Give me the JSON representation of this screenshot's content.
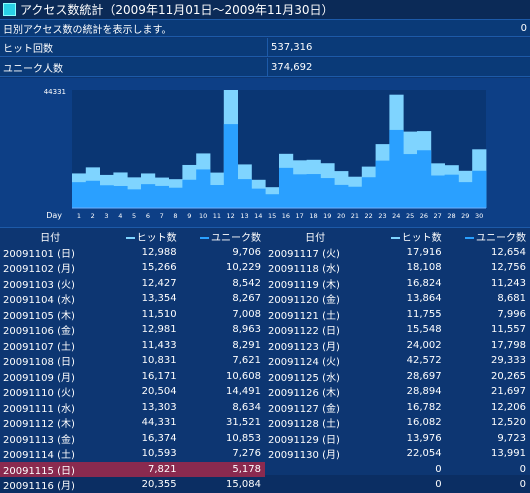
{
  "title": "アクセス数統計（2009年11月01日～2009年11月30日）",
  "subtitle": {
    "text": "日別アクセス数の統計を表示します。",
    "value": "0"
  },
  "summary": [
    {
      "label": "ヒット回数",
      "value": "537,316"
    },
    {
      "label": "ユニーク人数",
      "value": "374,692"
    }
  ],
  "table_headers": {
    "date": "日付",
    "hits": "ヒット数",
    "unique": "ユニーク数"
  },
  "left_rows": [
    {
      "date": "20091101 (日)",
      "hits": "12,988",
      "unique": "9,706"
    },
    {
      "date": "20091102 (月)",
      "hits": "15,266",
      "unique": "10,229"
    },
    {
      "date": "20091103 (火)",
      "hits": "12,427",
      "unique": "8,542"
    },
    {
      "date": "20091104 (水)",
      "hits": "13,354",
      "unique": "8,267"
    },
    {
      "date": "20091105 (木)",
      "hits": "11,510",
      "unique": "7,008"
    },
    {
      "date": "20091106 (金)",
      "hits": "12,981",
      "unique": "8,963"
    },
    {
      "date": "20091107 (土)",
      "hits": "11,433",
      "unique": "8,291"
    },
    {
      "date": "20091108 (日)",
      "hits": "10,831",
      "unique": "7,621"
    },
    {
      "date": "20091109 (月)",
      "hits": "16,171",
      "unique": "10,608"
    },
    {
      "date": "20091110 (火)",
      "hits": "20,504",
      "unique": "14,491"
    },
    {
      "date": "20091111 (水)",
      "hits": "13,303",
      "unique": "8,634"
    },
    {
      "date": "20091112 (木)",
      "hits": "44,331",
      "unique": "31,521"
    },
    {
      "date": "20091113 (金)",
      "hits": "16,374",
      "unique": "10,853"
    },
    {
      "date": "20091114 (土)",
      "hits": "10,593",
      "unique": "7,276"
    },
    {
      "date": "20091115 (日)",
      "hits": "7,821",
      "unique": "5,178"
    },
    {
      "date": "20091116 (月)",
      "hits": "20,355",
      "unique": "15,084"
    }
  ],
  "right_rows": [
    {
      "date": "20091117 (火)",
      "hits": "17,916",
      "unique": "12,654"
    },
    {
      "date": "20091118 (水)",
      "hits": "18,108",
      "unique": "12,756"
    },
    {
      "date": "20091119 (木)",
      "hits": "16,824",
      "unique": "11,243"
    },
    {
      "date": "20091120 (金)",
      "hits": "13,864",
      "unique": "8,681"
    },
    {
      "date": "20091121 (土)",
      "hits": "11,755",
      "unique": "7,996"
    },
    {
      "date": "20091122 (日)",
      "hits": "15,548",
      "unique": "11,557"
    },
    {
      "date": "20091123 (月)",
      "hits": "24,002",
      "unique": "17,798"
    },
    {
      "date": "20091124 (火)",
      "hits": "42,572",
      "unique": "29,333"
    },
    {
      "date": "20091125 (水)",
      "hits": "28,697",
      "unique": "20,265"
    },
    {
      "date": "20091126 (木)",
      "hits": "28,894",
      "unique": "21,697"
    },
    {
      "date": "20091127 (金)",
      "hits": "16,782",
      "unique": "12,206"
    },
    {
      "date": "20091128 (土)",
      "hits": "16,082",
      "unique": "12,520"
    },
    {
      "date": "20091129 (日)",
      "hits": "13,976",
      "unique": "9,723"
    },
    {
      "date": "20091130 (月)",
      "hits": "22,054",
      "unique": "13,991"
    },
    {
      "date": "",
      "hits": "0",
      "unique": "0"
    },
    {
      "date": "",
      "hits": "0",
      "unique": "0"
    }
  ],
  "highlight_row": "20091115 (日)",
  "colors": {
    "hits": "#7fd4ff",
    "unique": "#2aa0ff",
    "highlight": "#8a2a4f"
  },
  "chart_data": {
    "type": "area",
    "xlabel": "Day",
    "ymax_label": "44331",
    "ylim": [
      0,
      44331
    ],
    "x": [
      1,
      2,
      3,
      4,
      5,
      6,
      7,
      8,
      9,
      10,
      11,
      12,
      13,
      14,
      15,
      16,
      17,
      18,
      19,
      20,
      21,
      22,
      23,
      24,
      25,
      26,
      27,
      28,
      29,
      30
    ],
    "series": [
      {
        "name": "ヒット数",
        "values": [
          12988,
          15266,
          12427,
          13354,
          11510,
          12981,
          11433,
          10831,
          16171,
          20504,
          13303,
          44331,
          16374,
          10593,
          7821,
          20355,
          17916,
          18108,
          16824,
          13864,
          11755,
          15548,
          24002,
          42572,
          28697,
          28894,
          16782,
          16082,
          13976,
          22054
        ]
      },
      {
        "name": "ユニーク数",
        "values": [
          9706,
          10229,
          8542,
          8267,
          7008,
          8963,
          8291,
          7621,
          10608,
          14491,
          8634,
          31521,
          10853,
          7276,
          5178,
          15084,
          12654,
          12756,
          11243,
          8681,
          7996,
          11557,
          17798,
          29333,
          20265,
          21697,
          12206,
          12520,
          9723,
          13991
        ]
      }
    ]
  }
}
